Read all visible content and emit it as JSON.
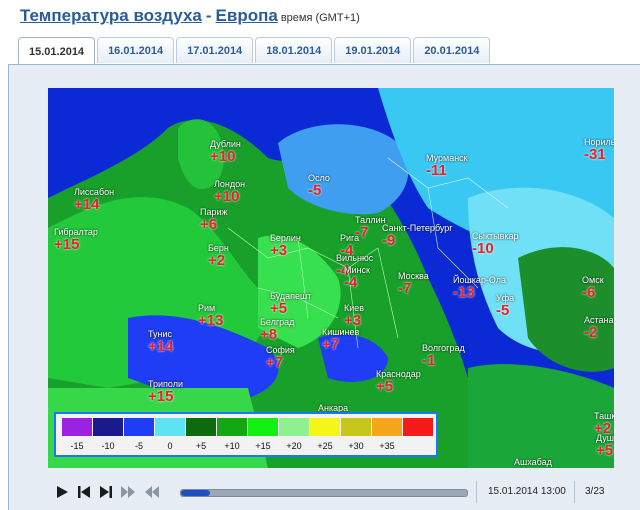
{
  "header": {
    "title": "Температура воздуха",
    "separator": "-",
    "region": "Европа",
    "timezone": "время (GMT+1)"
  },
  "tabs": [
    {
      "label": "15.01.2014",
      "active": true
    },
    {
      "label": "16.01.2014",
      "active": false
    },
    {
      "label": "17.01.2014",
      "active": false
    },
    {
      "label": "18.01.2014",
      "active": false
    },
    {
      "label": "19.01.2014",
      "active": false
    },
    {
      "label": "20.01.2014",
      "active": false
    }
  ],
  "cities": [
    {
      "name": "Дублин",
      "temp": "+10"
    },
    {
      "name": "Лиссабон",
      "temp": "+14"
    },
    {
      "name": "Лондон",
      "temp": "+10"
    },
    {
      "name": "Осло",
      "temp": "-5"
    },
    {
      "name": "Мурманск",
      "temp": "-11"
    },
    {
      "name": "Норильск",
      "temp": "-31"
    },
    {
      "name": "Гибралтар",
      "temp": "+15"
    },
    {
      "name": "Париж",
      "temp": "+6"
    },
    {
      "name": "Таллин",
      "temp": "-7"
    },
    {
      "name": "Санкт-Петербург",
      "temp": "-9"
    },
    {
      "name": "Сыктывкар",
      "temp": "-10"
    },
    {
      "name": "Берлин",
      "temp": "+3"
    },
    {
      "name": "Рига",
      "temp": "-4"
    },
    {
      "name": "Берн",
      "temp": "+2"
    },
    {
      "name": "Вильнюс",
      "temp": "-4"
    },
    {
      "name": "Минск",
      "temp": "-4"
    },
    {
      "name": "Москва",
      "temp": "-7"
    },
    {
      "name": "Йошкар-Ола",
      "temp": "-13"
    },
    {
      "name": "Омск",
      "temp": "-6"
    },
    {
      "name": "Уфа",
      "temp": "-5"
    },
    {
      "name": "Будапешт",
      "temp": "+5"
    },
    {
      "name": "Рим",
      "temp": "+13"
    },
    {
      "name": "Киев",
      "temp": "+3"
    },
    {
      "name": "Астана",
      "temp": "-2"
    },
    {
      "name": "Белград",
      "temp": "+8"
    },
    {
      "name": "Тунис",
      "temp": "+14"
    },
    {
      "name": "Кишинев",
      "temp": "+7"
    },
    {
      "name": "Волгоград",
      "temp": "-1"
    },
    {
      "name": "София",
      "temp": "+7"
    },
    {
      "name": "Краснодар",
      "temp": "+5"
    },
    {
      "name": "Триполи",
      "temp": "+15"
    },
    {
      "name": "Анкара",
      "temp": ""
    },
    {
      "name": "Ташкент",
      "temp": "+2"
    },
    {
      "name": "Душанбе",
      "temp": "+5"
    },
    {
      "name": "Ашхабад",
      "temp": ""
    }
  ],
  "legend": [
    {
      "label": "-15",
      "color": "#9b22e0"
    },
    {
      "label": "-10",
      "color": "#1a1a8c"
    },
    {
      "label": "-5",
      "color": "#1e3df5"
    },
    {
      "label": "0",
      "color": "#5de3f5"
    },
    {
      "label": "+5",
      "color": "#0d6b0d"
    },
    {
      "label": "+10",
      "color": "#13a813"
    },
    {
      "label": "+15",
      "color": "#12f012"
    },
    {
      "label": "+20",
      "color": "#8ef08e"
    },
    {
      "label": "+25",
      "color": "#f5f51a"
    },
    {
      "label": "+30",
      "color": "#c6c61c"
    },
    {
      "label": "+35",
      "color": "#f5a61a"
    },
    {
      "label": "",
      "color": "#f51a1a"
    }
  ],
  "player": {
    "datetime": "15.01.2014 13:00",
    "frame": "3/23",
    "progress": 0.1,
    "buttons": [
      {
        "name": "play-icon"
      },
      {
        "name": "step-back-icon"
      },
      {
        "name": "step-forward-icon"
      },
      {
        "name": "fast-forward-icon"
      },
      {
        "name": "rewind-icon"
      }
    ]
  }
}
